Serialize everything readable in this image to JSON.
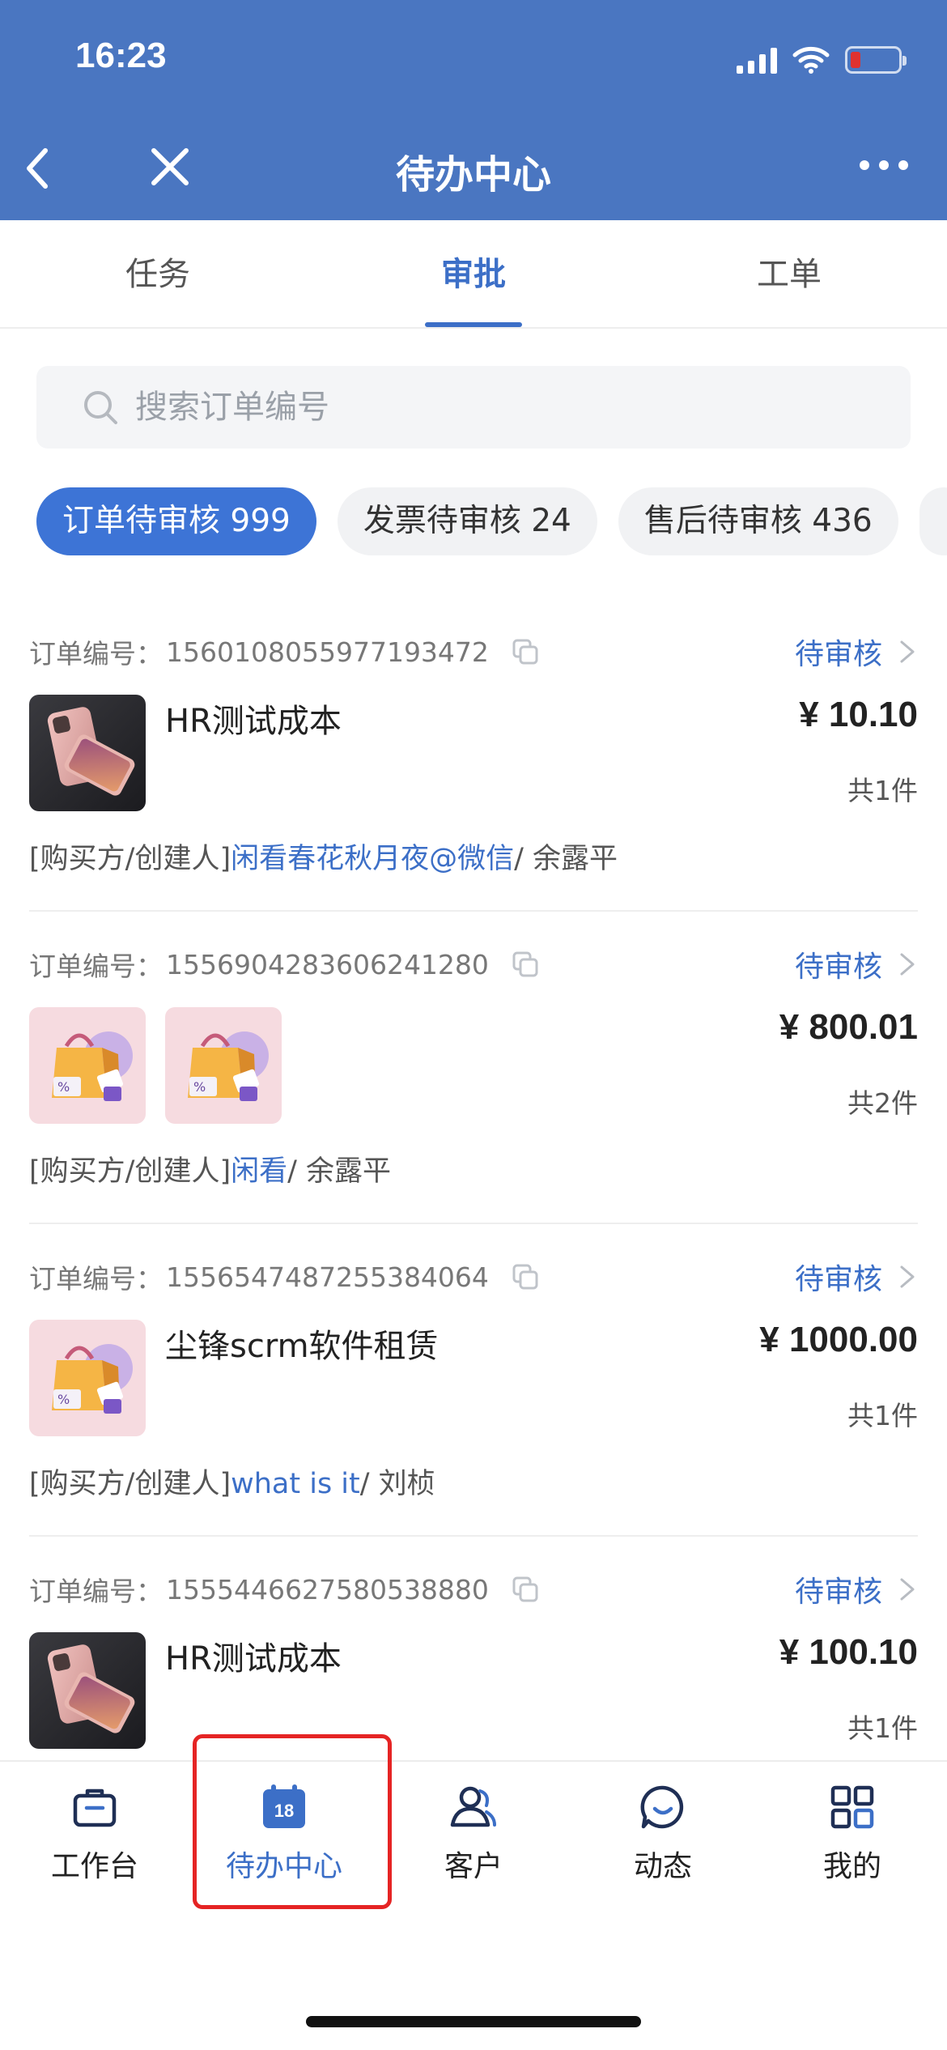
{
  "status_bar": {
    "time": "16:23"
  },
  "header": {
    "title": "待办中心"
  },
  "tabs": [
    {
      "label": "任务",
      "active": false
    },
    {
      "label": "审批",
      "active": true
    },
    {
      "label": "工单",
      "active": false
    }
  ],
  "search": {
    "placeholder": "搜索订单编号"
  },
  "chips": [
    {
      "label": "订单待审核 999",
      "active": true
    },
    {
      "label": "发票待审核 24",
      "active": false
    },
    {
      "label": "售后待审核 436",
      "active": false
    }
  ],
  "orders": [
    {
      "no_label": "订单编号：",
      "no": "1560108055977193472",
      "status": "待审核",
      "product": "HR测试成本",
      "price": "¥ 10.10",
      "qty": "共1件",
      "buyer_prefix": "[购买方/创建人]",
      "buyer_name": "闲看春花秋月夜@微信",
      "creator": "/ 余露平",
      "thumbs": [
        "phone"
      ]
    },
    {
      "no_label": "订单编号：",
      "no": "1556904283606241280",
      "status": "待审核",
      "product": "",
      "price": "¥ 800.01",
      "qty": "共2件",
      "buyer_prefix": "[购买方/创建人]",
      "buyer_name": "闲看",
      "creator": "/ 余露平",
      "thumbs": [
        "bag",
        "bag"
      ]
    },
    {
      "no_label": "订单编号：",
      "no": "1556547487255384064",
      "status": "待审核",
      "product": "尘锋scrm软件租赁",
      "price": "¥ 1000.00",
      "qty": "共1件",
      "buyer_prefix": "[购买方/创建人]",
      "buyer_name": "what is it",
      "creator": "/ 刘桢",
      "thumbs": [
        "bag"
      ]
    },
    {
      "no_label": "订单编号：",
      "no": "1555446627580538880",
      "status": "待审核",
      "product": "HR测试成本",
      "price": "¥ 100.10",
      "qty": "共1件",
      "thumbs": [
        "phone"
      ]
    }
  ],
  "bottom_nav": [
    {
      "label": "工作台",
      "icon": "briefcase-icon",
      "active": false
    },
    {
      "label": "待办中心",
      "icon": "calendar-icon",
      "badge": "18",
      "active": true
    },
    {
      "label": "客户",
      "icon": "customer-icon",
      "active": false
    },
    {
      "label": "动态",
      "icon": "chat-icon",
      "active": false
    },
    {
      "label": "我的",
      "icon": "grid-icon",
      "active": false
    }
  ],
  "colors": {
    "header_bg": "#4a76c1",
    "accent": "#3c6fc7",
    "chip_active": "#3d74d6",
    "highlight": "#e52424"
  }
}
